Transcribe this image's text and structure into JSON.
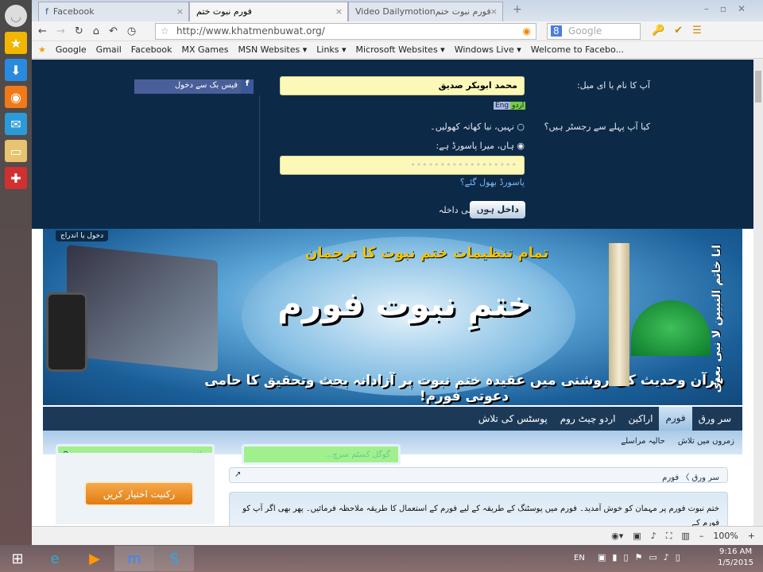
{
  "browser": {
    "tabs": [
      {
        "label": "Facebook"
      },
      {
        "label": "فورم نبوت ختم"
      },
      {
        "label": "Video Dailymotionفورم نبوت ختم ..."
      }
    ],
    "url": "http://www.khatmenbuwat.org/",
    "search_placeholder": "Google",
    "bookmarks": [
      "Google",
      "Gmail",
      "Facebook",
      "MX Games",
      "MSN Websites ▾",
      "Links ▾",
      "Microsoft Websites ▾",
      "Windows Live ▾",
      "Welcome to Facebo..."
    ],
    "zoom": "100%"
  },
  "login": {
    "name_label": "آپ کا نام یا ای میل:",
    "name_value": "محمد ابوبکر صدیق",
    "lang_eng": "Eng",
    "lang_urdu": "اردو",
    "registered_label": "کیا آپ پہلے سے رجسٹر ہیں؟",
    "option_no": "نہیں، نیا کھاتہ کھولیں۔",
    "option_yes": "ہاں، میرا پاسورڈ ہے:",
    "password_mask": "••••••••••••••••••",
    "forgot": "پاسورڈ بھول گئے؟",
    "submit": "داخل ہوں",
    "remember": "دائمی داخلہ",
    "facebook_login": "فیس بک سے دخول"
  },
  "banner": {
    "register_tab": "دخول یا اندراج",
    "subtitle": "تمام تنظیمات ختم نبوت کا ترجمان",
    "title": "ختمِ نبوت فورم",
    "tagline": "قرآن وحدیث کی روشنی میں عقیدہ ختم نبوت پر آزادانہ بحث وتحقیق کا حامی دعوتی فورم!",
    "vertical": "انا خاتم النبیین لا نبی بعدی"
  },
  "nav": {
    "items": [
      "سر ورق",
      "فورم",
      "اراکین",
      "اردو چیٹ روم",
      "پوسٹس کی تلاش"
    ],
    "sub": [
      "زمروں میں تلاش",
      "حالیہ مراسلے"
    ]
  },
  "search": {
    "site_placeholder": "تلاش...",
    "google_placeholder": "گوگل کسٹم سرچ..."
  },
  "join_button": "رکنیت اختیار کریں",
  "breadcrumb": [
    "سر ورق",
    "فورم"
  ],
  "notice": "ختم نبوت فورم پر مہمان کو خوش آمدید۔ فورم میں پوسٹنگ کے طریقہ کے لیے فورم کے استعمال کا طریقہ ملاحظہ فرمائیں۔ پھر بھی اگر آپ کو فورم کے",
  "taskbar": {
    "lang": "EN",
    "time": "9:16 AM",
    "date": "1/5/2015"
  }
}
